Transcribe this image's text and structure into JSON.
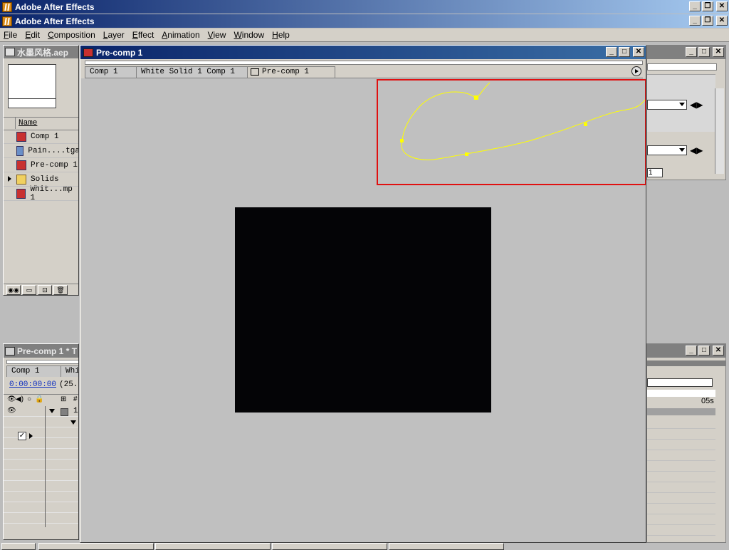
{
  "app": {
    "outer_title": "Adobe After Effects",
    "inner_title": "Adobe After Effects",
    "window_buttons": [
      "_",
      "❐",
      "✕"
    ]
  },
  "menu": [
    "File",
    "Edit",
    "Composition",
    "Layer",
    "Effect",
    "Animation",
    "View",
    "Window",
    "Help"
  ],
  "project": {
    "title": "水墨风格.aep",
    "column_name": "Name",
    "items": [
      {
        "label": "Comp 1",
        "icon": "composition-icon"
      },
      {
        "label": "Pain....tga",
        "icon": "footage-icon"
      },
      {
        "label": "Pre-comp 1",
        "icon": "composition-icon"
      },
      {
        "label": "Solids",
        "icon": "folder-icon"
      },
      {
        "label": "Whit...mp 1",
        "icon": "composition-icon"
      }
    ],
    "footer_buttons": [
      "find-icon",
      "new-folder-icon",
      "new-comp-icon",
      "trash-icon"
    ]
  },
  "comp_window": {
    "title": "Pre-comp 1",
    "tabs": [
      "Comp 1",
      "White Solid 1 Comp 1",
      "Pre-comp 1"
    ],
    "canvas_color": "#c0c0c0",
    "solid_color": "#040406",
    "path_color": "#ffff00",
    "highlight_color": "#e01010"
  },
  "timeline": {
    "title": "Pre-comp 1 * T",
    "tabs": [
      "Comp 1",
      "Whi"
    ],
    "timecode": "0:00:00:00",
    "fps": "(25.0",
    "layer_number": "1",
    "right_time_label": "05s"
  },
  "right_panel": {
    "dropdown_label": "1"
  }
}
